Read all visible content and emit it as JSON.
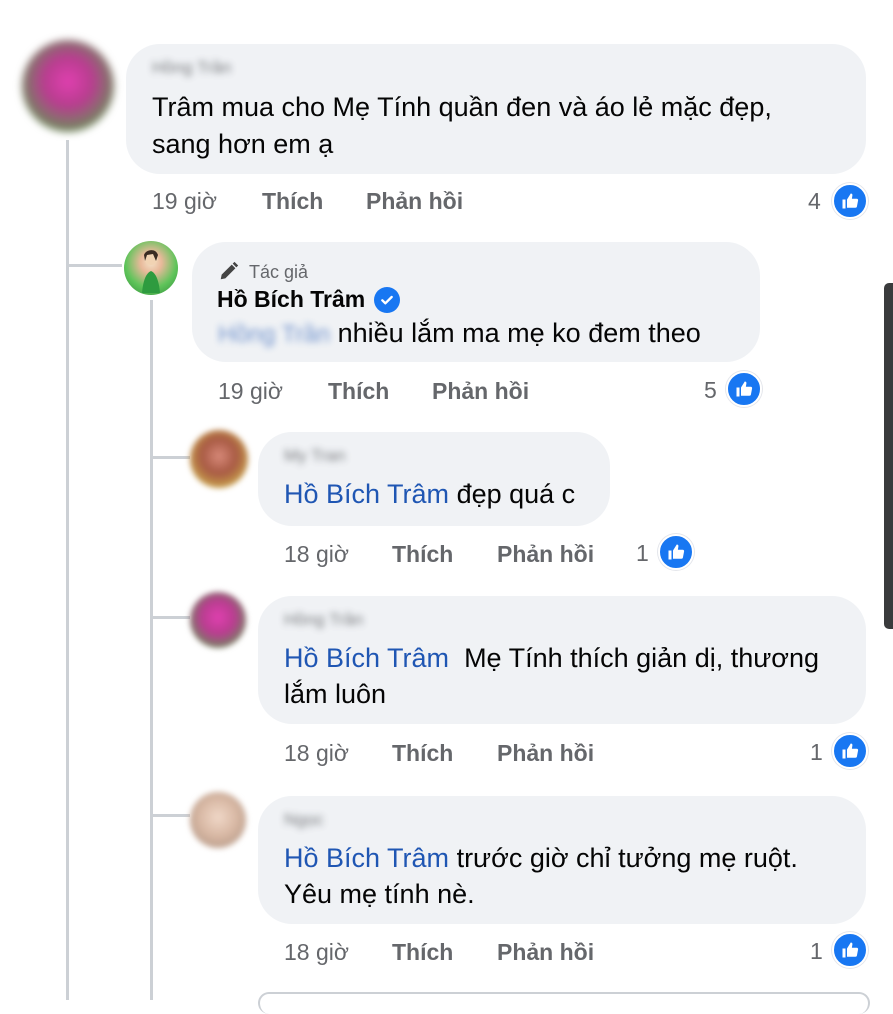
{
  "comments": [
    {
      "name": "Hồng Trần",
      "text_lines": [
        "Trâm mua cho Mẹ Tính quần đen và áo lẻ mặc đẹp,",
        "sang hơn em ạ"
      ],
      "time": "19 giờ",
      "like_label": "Thích",
      "reply_label": "Phản hồi",
      "reactions": "4"
    },
    {
      "author_label": "Tác giả",
      "name": "Hồ Bích Trâm",
      "mention": "Hồng Trần",
      "text": "nhiều lắm ma mẹ ko đem theo",
      "time": "19 giờ",
      "like_label": "Thích",
      "reply_label": "Phản hồi",
      "reactions": "5"
    },
    {
      "name": "My Tran",
      "mention": "Hồ Bích Trâm",
      "text": "đẹp quá c",
      "time": "18 giờ",
      "like_label": "Thích",
      "reply_label": "Phản hồi",
      "reactions": "1"
    },
    {
      "name": "Hồng Trần",
      "mention": "Hồ Bích Trâm",
      "text_lines": [
        "Mẹ Tính thích giản dị, thương",
        "lắm luôn"
      ],
      "time": "18 giờ",
      "like_label": "Thích",
      "reply_label": "Phản hồi",
      "reactions": "1"
    },
    {
      "name": "Ngọc",
      "mention": "Hồ Bích Trâm",
      "text_lines": [
        "trước giờ chỉ tưởng mẹ ruột.",
        "Yêu mẹ tính nè."
      ],
      "time": "18 giờ",
      "like_label": "Thích",
      "reply_label": "Phản hồi",
      "reactions": "1"
    }
  ],
  "colors": {
    "mention": "#1f56b3",
    "bubble": "#f0f2f5",
    "like_blue": "#1877f2",
    "meta": "#65676b"
  },
  "icons": {
    "like": "thumbs-up-icon",
    "verified": "verified-check-icon",
    "author": "pencil-icon"
  }
}
